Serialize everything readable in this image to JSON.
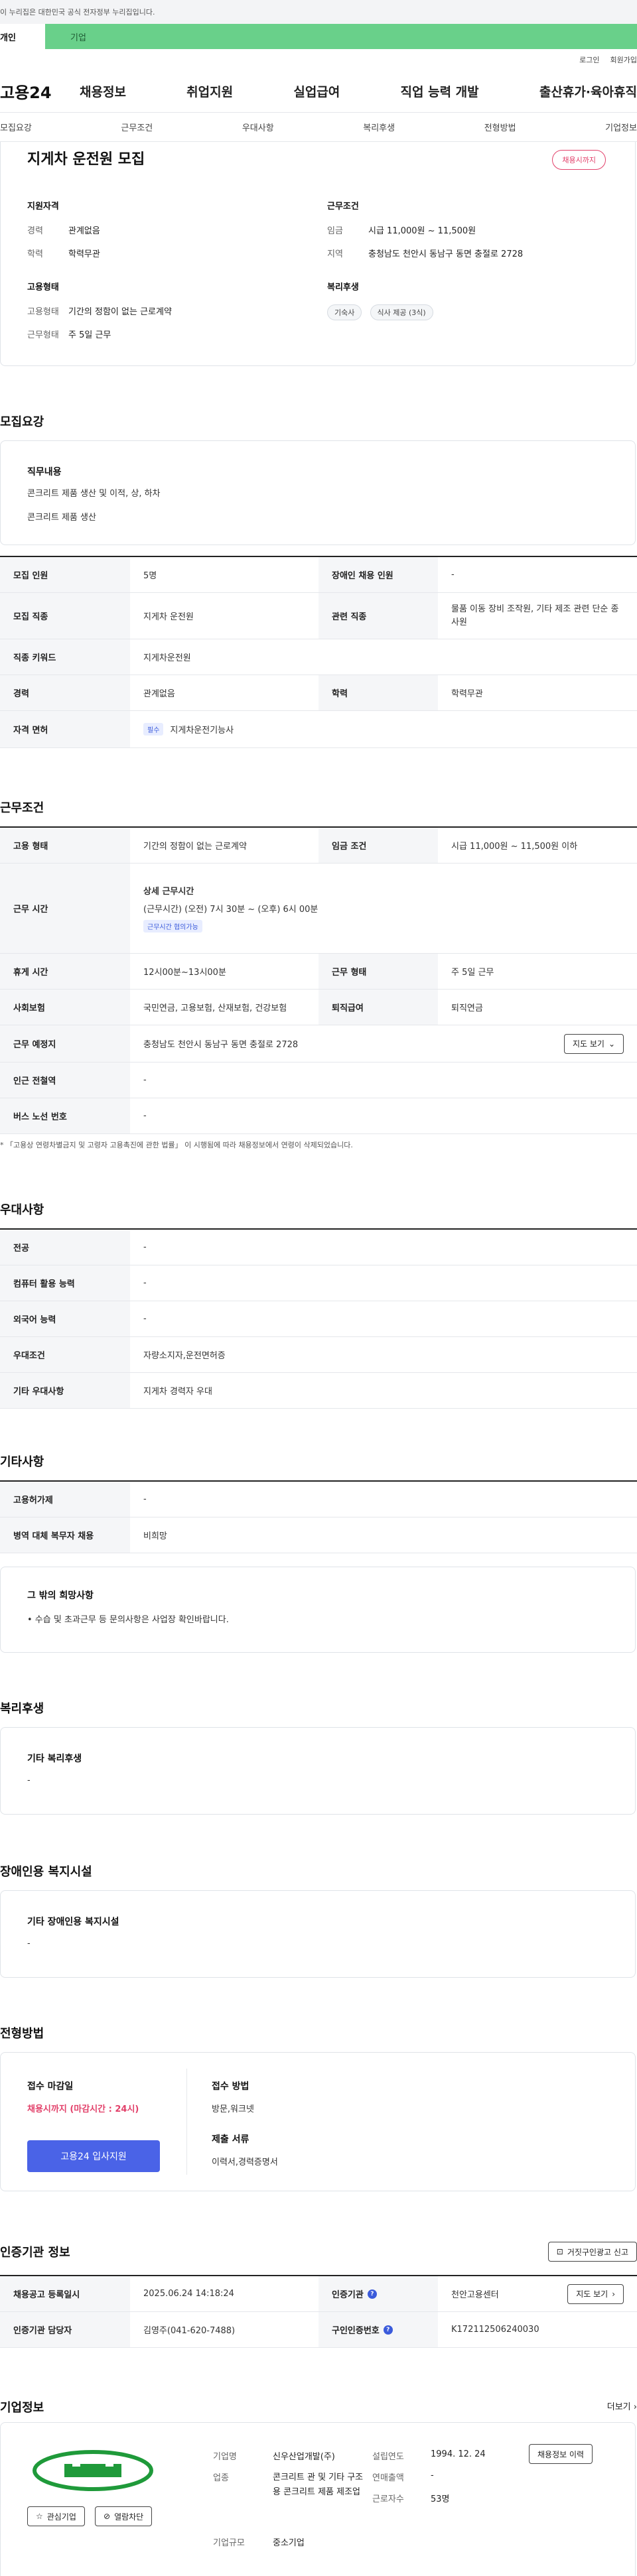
{
  "gov_banner": "이 누리집은 대한민국 공식 전자정부 누리집입니다.",
  "service_tabs": {
    "personal": "개인",
    "company": "기업"
  },
  "util": {
    "login": "로그인",
    "join": "회원가입"
  },
  "logo": "고용24",
  "gnb": [
    "채용정보",
    "취업지원",
    "실업급여",
    "직업 능력 개발",
    "출산휴가·육아휴직"
  ],
  "anchor_nav": [
    "모집요강",
    "근무조건",
    "우대사항",
    "복리후생",
    "전형방법",
    "기업정보"
  ],
  "job": {
    "title": "지게차 운전원 모집",
    "status": "채용시까지",
    "qual_head": "지원자격",
    "qual_rows": [
      {
        "k": "경력",
        "v": "관계없음"
      },
      {
        "k": "학력",
        "v": "학력무관"
      }
    ],
    "cond_head": "근무조건",
    "cond_rows": [
      {
        "k": "임금",
        "v": "시급 11,000원 ~ 11,500원"
      },
      {
        "k": "지역",
        "v": "충청남도 천안시 동남구 동면 충절로 2728"
      }
    ],
    "emp_head": "고용형태",
    "emp_rows": [
      {
        "k": "고용형태",
        "v": "기간의 정함이 없는 근로계약"
      },
      {
        "k": "근무형태",
        "v": "주 5일 근무"
      }
    ],
    "welfare_head": "복리후생",
    "welfare_chips": [
      "기숙사",
      "식사 제공 (3식)"
    ]
  },
  "recruit": {
    "title": "모집요강",
    "duty_head": "직무내용",
    "duty_lines": [
      "콘크리트 제품 생산 및 이적, 상, 하차",
      "콘크리트 제품 생산"
    ],
    "rows": [
      {
        "k1": "모집 인원",
        "v1": "5명",
        "k2": "장애인 채용 인원",
        "v2": "-"
      },
      {
        "k1": "모집 직종",
        "v1": "지게차 운전원",
        "k2": "관련 직종",
        "v2": "물품 이동 장비 조작원, 기타 제조 관련 단순 종사원"
      },
      {
        "k1": "직종 키워드",
        "v1": "지게차운전원"
      },
      {
        "k1": "경력",
        "v1": "관계없음",
        "k2": "학력",
        "v2": "학력무관"
      },
      {
        "k1": "자격 면허",
        "tag": "필수",
        "v1": "지게차운전기능사"
      }
    ]
  },
  "conditions": {
    "title": "근무조건",
    "employ_k": "고용 형태",
    "employ_v": "기간의 정함이 없는 근로계약",
    "wage_k": "임금 조건",
    "wage_v": "시급 11,000원 ~ 11,500원 이하",
    "hours_k": "근무 시간",
    "hours_head": "상세 근무시간",
    "hours_line": "(근무시간) (오전) 7시 30분 ~ (오후) 6시 00분",
    "hours_tag": "근무시간 협의가능",
    "rest_k": "휴게 시간",
    "rest_v": "12시00분~13시00분",
    "shift_k": "근무 형태",
    "shift_v": "주 5일 근무",
    "insure_k": "사회보험",
    "insure_v": "국민연금, 고용보험, 산재보험, 건강보험",
    "retire_k": "퇴직급여",
    "retire_v": "퇴직연금",
    "place_k": "근무 예정지",
    "place_v": "충청남도 천안시 동남구 동면 충절로 2728",
    "map_btn": "지도 보기",
    "subway_k": "인근 전철역",
    "subway_v": "-",
    "bus_k": "버스 노선 번호",
    "bus_v": "-",
    "note": "* 「고용상 연령차별금지 및 고령자 고용촉진에 관한 법률」 이 시행됨에 따라 채용정보에서 연령이 삭제되었습니다."
  },
  "preference": {
    "title": "우대사항",
    "rows": [
      {
        "k": "전공",
        "v": "-"
      },
      {
        "k": "컴퓨터 활용 능력",
        "v": "-"
      },
      {
        "k": "외국어 능력",
        "v": "-"
      },
      {
        "k": "우대조건",
        "v": "자량소지자,운전면허증"
      },
      {
        "k": "기타 우대사항",
        "v": "지게차 경력자 우대"
      }
    ]
  },
  "etc": {
    "title": "기타사항",
    "rows": [
      {
        "k": "고용허가제",
        "v": "-"
      },
      {
        "k": "병역 대체 복무자 채용",
        "v": "비희망"
      }
    ],
    "box_head": "그 밖의 희망사항",
    "box_text": "• 수습 및 초과근무 등 문의사항은 사업장 확인바랍니다."
  },
  "welfare": {
    "title": "복리후생",
    "box_head": "기타 복리후생",
    "box_text": "-"
  },
  "disability": {
    "title": "장애인용 복지시설",
    "box_head": "기타 장애인용 복지시설",
    "box_text": "-"
  },
  "selection": {
    "title": "전형방법",
    "deadline_k": "접수 마감일",
    "deadline_v": "채용시까지 (마감시간 : 24시)",
    "apply_btn": "고용24 입사지원",
    "method_k": "접수 방법",
    "method_v": "방문,워크넷",
    "docs_k": "제출 서류",
    "docs_v": "이력서,경력증명서"
  },
  "certification": {
    "title": "인증기관 정보",
    "report_btn": "거짓구인광고 신고",
    "reg_k": "채용공고 등록일시",
    "reg_v": "2025.06.24 14:18:24",
    "org_k": "인증기관",
    "org_v": "천안고용센터",
    "manager_k": "인증기관 담당자",
    "manager_v": "김영주(041-620-7488)",
    "num_k": "구인인증번호",
    "num_v": "K172112506240030",
    "map_btn": "지도 보기"
  },
  "company": {
    "title": "기업정보",
    "more": "더보기",
    "fav_btn": "관심기업",
    "block_btn": "열람차단",
    "name_k": "기업명",
    "name_v": "신우산업개발(주)",
    "biz_k": "업종",
    "biz_v": "콘크리트 관 및 기타 구조용 콘크리트 제품 제조업",
    "scale_k": "기업규모",
    "scale_v": "중소기업",
    "est_k": "설립연도",
    "est_v": "1994. 12. 24",
    "sales_k": "연매출액",
    "sales_v": "-",
    "emp_k": "근로자수",
    "emp_v": "53명",
    "history_btn": "채용정보 이력"
  },
  "colors": {
    "accent": "#4a63e7",
    "brand_green": "#69d08a",
    "alert": "#e2416a"
  }
}
